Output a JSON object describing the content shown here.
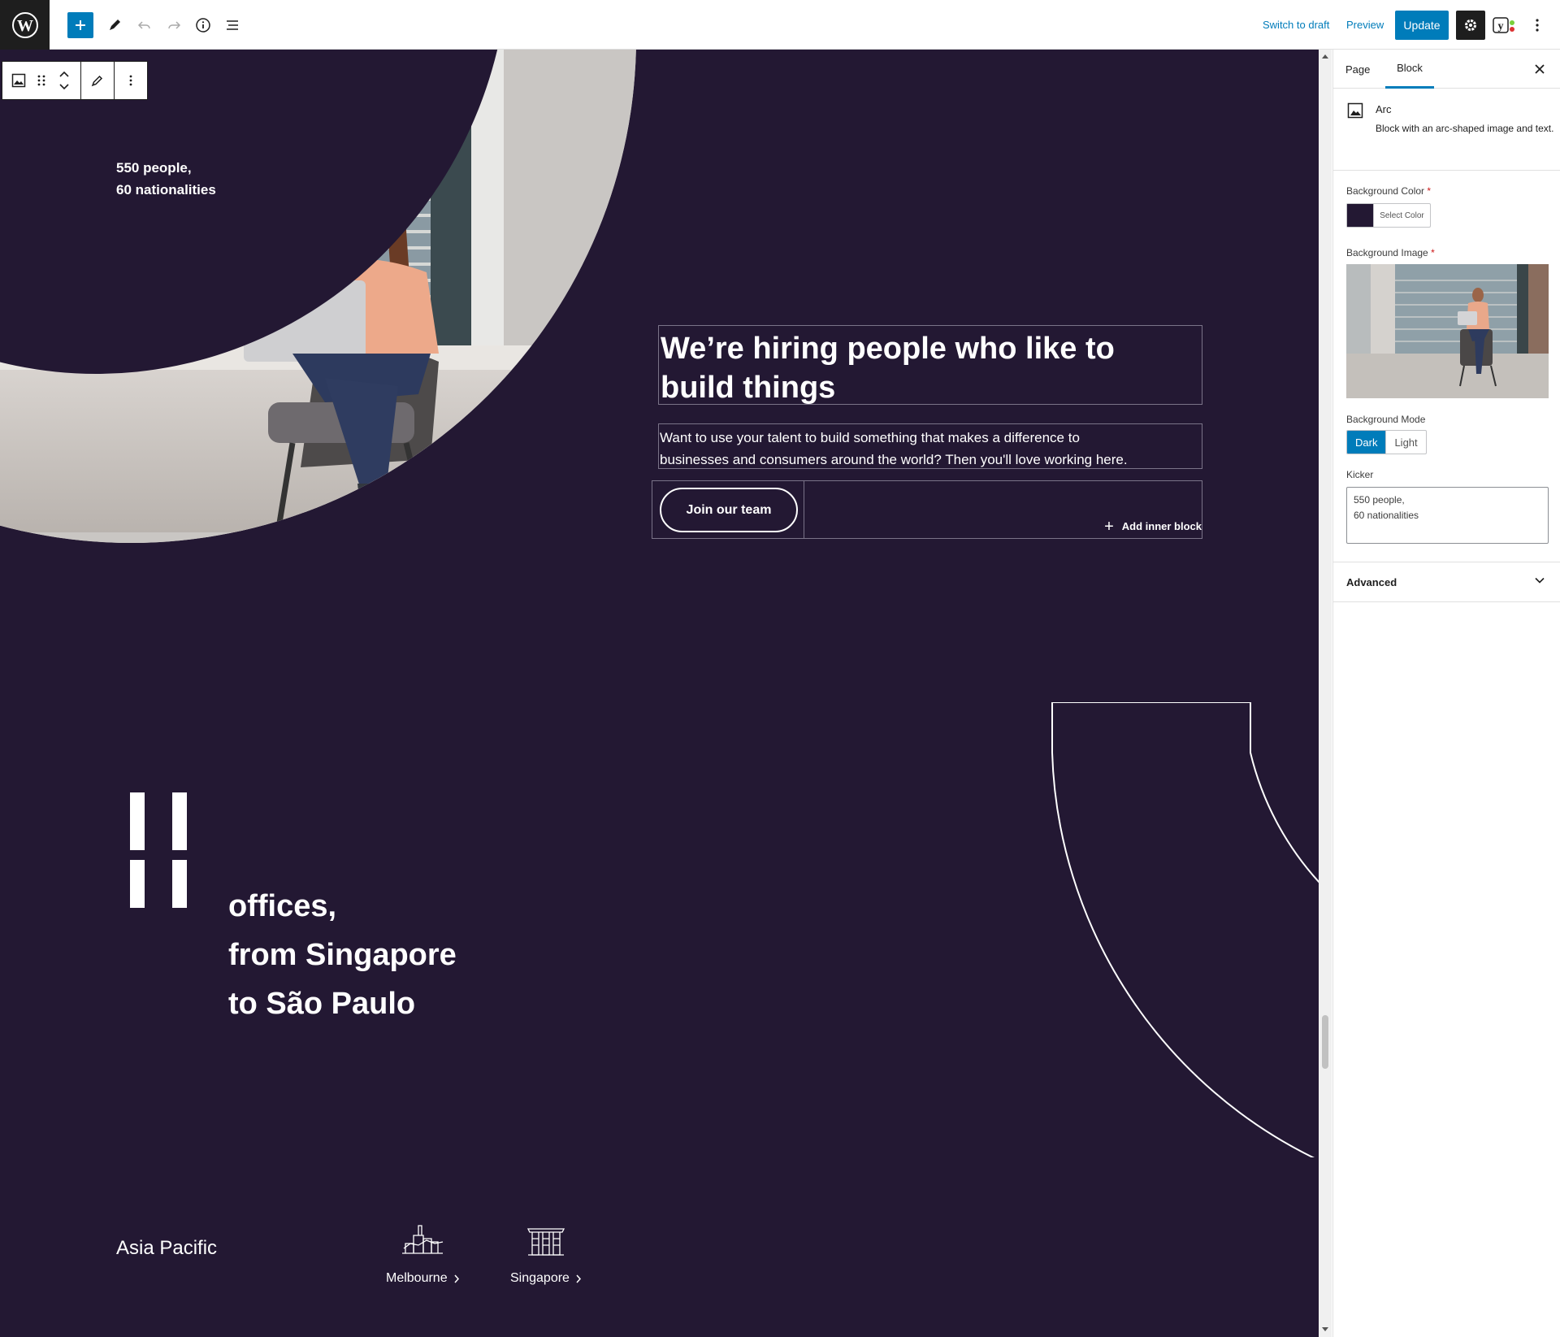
{
  "topbar": {
    "switch_to_draft": "Switch to draft",
    "preview": "Preview",
    "update": "Update",
    "icons": [
      "wordpress-logo",
      "plus",
      "pencil",
      "undo",
      "redo",
      "info",
      "list-view",
      "gear",
      "yoast",
      "more-vertical"
    ]
  },
  "canvas": {
    "background": "#231833",
    "block_toolbar_icons": [
      "image",
      "drag-handle",
      "move-up-down",
      "pencil",
      "more-vertical"
    ],
    "kicker": {
      "line1": "550 people,",
      "line2": "60 nationalities"
    },
    "heading_line1": "We’re hiring people who like to",
    "heading_line2": "build things",
    "description_line1": "Want to use your talent to build something that makes a difference to",
    "description_line2": "businesses and consumers around the world? Then you'll love working here.",
    "cta_label": "Join our team",
    "add_inner_block": "Add inner block",
    "offices": {
      "count": "11",
      "line1": "offices,",
      "line2": "from Singapore",
      "line3": "to São Paulo"
    },
    "region": {
      "title": "Asia Pacific",
      "cities": [
        {
          "name": "Melbourne",
          "icon": "melbourne-building-icon"
        },
        {
          "name": "Singapore",
          "icon": "singapore-building-icon"
        }
      ]
    }
  },
  "sidebar": {
    "tabs": [
      "Page",
      "Block"
    ],
    "active_tab": "Block",
    "block": {
      "title": "Arc",
      "description": "Block with an arc-shaped image and text."
    },
    "background_color": {
      "label": "Background Color",
      "button": "Select Color",
      "value": "#231833"
    },
    "background_image": {
      "label": "Background Image"
    },
    "background_mode": {
      "label": "Background Mode",
      "options": [
        "Dark",
        "Light"
      ],
      "selected": "Dark"
    },
    "kicker_field": {
      "label": "Kicker",
      "value": "550 people,\n60 nationalities"
    },
    "advanced_label": "Advanced"
  },
  "colors": {
    "accent": "#007cba",
    "dark": "#1e1e1e",
    "canvas": "#231833"
  }
}
